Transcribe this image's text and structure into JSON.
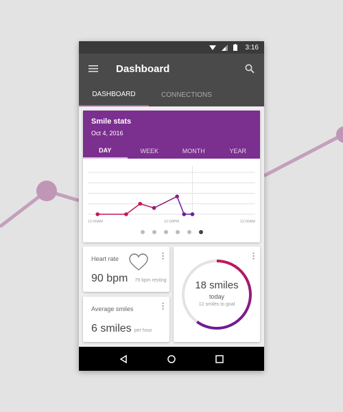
{
  "status": {
    "time": "3:16",
    "icons": [
      "wifi-icon",
      "signal-icon",
      "battery-icon"
    ]
  },
  "appbar": {
    "title": "Dashboard",
    "menu_icon": "menu-icon",
    "search_icon": "search-icon"
  },
  "tabs": [
    {
      "label": "DASHBOARD",
      "active": true
    },
    {
      "label": "CONNECTIONS",
      "active": false
    }
  ],
  "stats": {
    "title": "Smile stats",
    "date": "Oct 4, 2016",
    "ranges": [
      "DAY",
      "WEEK",
      "MONTH",
      "YEAR"
    ],
    "active_range": "DAY",
    "page_count": 6,
    "active_page": 6
  },
  "chart_data": {
    "type": "line",
    "x_tick_labels": [
      "12:00AM",
      "12:00PM",
      "12:00AM"
    ],
    "xlim": [
      0,
      24
    ],
    "ylim": [
      0,
      4
    ],
    "grid": true,
    "points": [
      {
        "x": 1.4,
        "y": 0
      },
      {
        "x": 5.5,
        "y": 0
      },
      {
        "x": 7.5,
        "y": 1
      },
      {
        "x": 9.5,
        "y": 0.6
      },
      {
        "x": 12.8,
        "y": 1.7
      },
      {
        "x": 13.8,
        "y": 0
      },
      {
        "x": 15,
        "y": 0
      }
    ],
    "current_x": 15,
    "colors": [
      "#c2185b",
      "#6a1b9a"
    ]
  },
  "heart": {
    "label": "Heart rate",
    "value": "90 bpm",
    "sub": "79 bpm resting",
    "icon": "heart-icon"
  },
  "avg": {
    "label": "Average smiles",
    "value": "6 smiles",
    "unit": "per hour"
  },
  "goal": {
    "value": "18 smiles",
    "period": "today",
    "sub": "12 smiles to goal",
    "progress": 0.6
  },
  "nav": {
    "icons": [
      "back-icon",
      "home-icon",
      "recents-icon"
    ]
  }
}
